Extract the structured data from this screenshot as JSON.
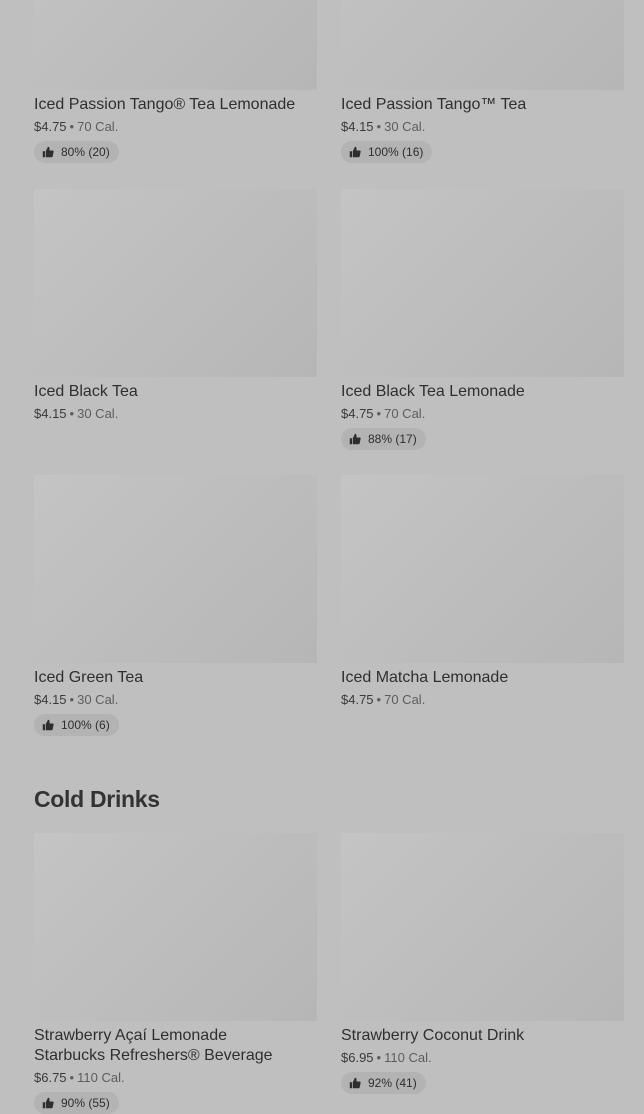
{
  "rows1": [
    {
      "name": "Iced Passion Tango® Tea Lemonade",
      "price": "$4.75",
      "cal": "70 Cal.",
      "rating": "80% (20)"
    },
    {
      "name": "Iced Passion Tango™ Tea",
      "price": "$4.15",
      "cal": "30 Cal.",
      "rating": "100% (16)"
    }
  ],
  "rows2": [
    {
      "name": "Iced Black Tea",
      "price": "$4.15",
      "cal": "30 Cal."
    },
    {
      "name": "Iced Black Tea Lemonade",
      "price": "$4.75",
      "cal": "70 Cal.",
      "rating": "88% (17)"
    }
  ],
  "rows3": [
    {
      "name": "Iced Green Tea",
      "price": "$4.15",
      "cal": "30 Cal.",
      "rating": "100% (6)"
    },
    {
      "name": "Iced Matcha Lemonade",
      "price": "$4.75",
      "cal": "70 Cal."
    }
  ],
  "section": {
    "title": "Cold Drinks"
  },
  "rows4": [
    {
      "name": "Strawberry Açaí Lemonade Starbucks Refreshers® Beverage",
      "price": "$6.75",
      "cal": "110 Cal.",
      "rating": "90% (55)"
    },
    {
      "name": "Strawberry Coconut Drink",
      "price": "$6.95",
      "cal": "110 Cal.",
      "rating": "92% (41)"
    }
  ],
  "separator": "•",
  "icons": {
    "rating": "thumbs-up-icon"
  }
}
